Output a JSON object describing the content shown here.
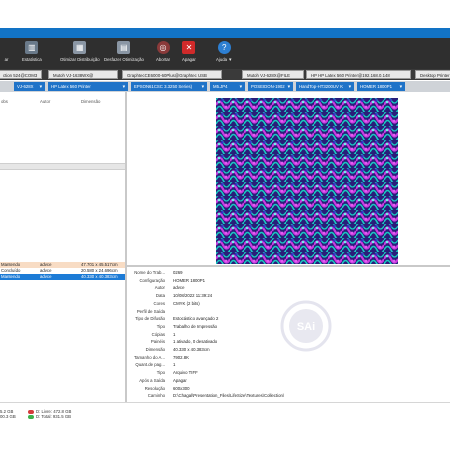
{
  "toolbar": {
    "buttons": [
      {
        "label": "Estatística",
        "icon": "bar-chart-icon"
      },
      {
        "label": "Otimizar Distribuição",
        "icon": "optimize-icon"
      },
      {
        "label": "Desfazer Otimização",
        "icon": "undo-optimize-icon"
      },
      {
        "label": "Abortar",
        "icon": "abort-icon"
      },
      {
        "label": "Apagar",
        "icon": "delete-icon"
      },
      {
        "label": "Ajuda ▼",
        "icon": "help-icon"
      }
    ],
    "partial_label": "ar"
  },
  "printer_tabs": [
    "ction 524@COM3",
    "Mutoh VJ-1638WX@",
    "GraphtecCE6000-60Plus@Graphtec USB",
    "Mutoh VJ-628X@FILE",
    "HP HP Latex 560 Printer@192.168.0.148",
    "Desktop Printer"
  ],
  "queue_tabs": [
    "VJ-628X",
    "HP Latex 560 Printer",
    "EPSON61CSC 3.3250 Series)",
    "M5.JP4",
    "POSEIDON-1902",
    "HandTop-HT3200UV K",
    "HOMER 1800P1"
  ],
  "job_list": {
    "columns": [
      "obs",
      "Autor",
      "Dimensão"
    ]
  },
  "jobs": [
    {
      "status": "Mantendo",
      "author": "advce",
      "dim": "47.701 x 45.517cm"
    },
    {
      "status": "Concluído",
      "author": "advce",
      "dim": "20.580 x 24.696cm"
    },
    {
      "status": "Mantendo",
      "author": "advce",
      "dim": "40.330 x 40.383cm"
    }
  ],
  "properties": [
    {
      "k": "Nome do Trab...",
      "v": "0269"
    },
    {
      "k": "Configuração",
      "v": "HOMER 1800P1"
    },
    {
      "k": "Autor",
      "v": "advce"
    },
    {
      "k": "Data",
      "v": "10/08/2022 11:39:24"
    },
    {
      "k": "Cores",
      "v": "CMYK (2 bits)"
    },
    {
      "k": "Perfil de Saída",
      "v": ""
    },
    {
      "k": "Tipo de Difusão",
      "v": "Estocástico avançado 2"
    },
    {
      "k": "Tipo",
      "v": "Trabalho de Impressão"
    },
    {
      "k": "Cópias",
      "v": "1"
    },
    {
      "k": "Painéis",
      "v": "1 ativado, 0 desativado"
    },
    {
      "k": "Dimensão",
      "v": "40.330 x 40.383cm"
    },
    {
      "k": "Tamanho do A...",
      "v": "7902.8K"
    },
    {
      "k": "Quant.de pag...",
      "v": "1"
    },
    {
      "k": "Tipo",
      "v": "Arquivo TIFF"
    },
    {
      "k": "Após a Saída",
      "v": "Apagar"
    },
    {
      "k": "Resolução",
      "v": "600x300"
    },
    {
      "k": "Caminho",
      "v": "D:\\Chagal\\Presentation_Files\\LifeSize\\Textures\\Collection\\"
    }
  ],
  "status": {
    "left1": "5.2 GB",
    "left2": "00.3 GB",
    "disk_free": "D: Livre: 472.8 GB",
    "disk_total": "D: Total: 931.5 GB"
  },
  "watermark_text": "SAi",
  "colors": {
    "accent": "#1273c5",
    "toolbar_bg": "#2f2f2f",
    "queue_tab": "#1f73c8",
    "selected_row": "#1c7bd6",
    "held_row": "#f8dcc4"
  }
}
